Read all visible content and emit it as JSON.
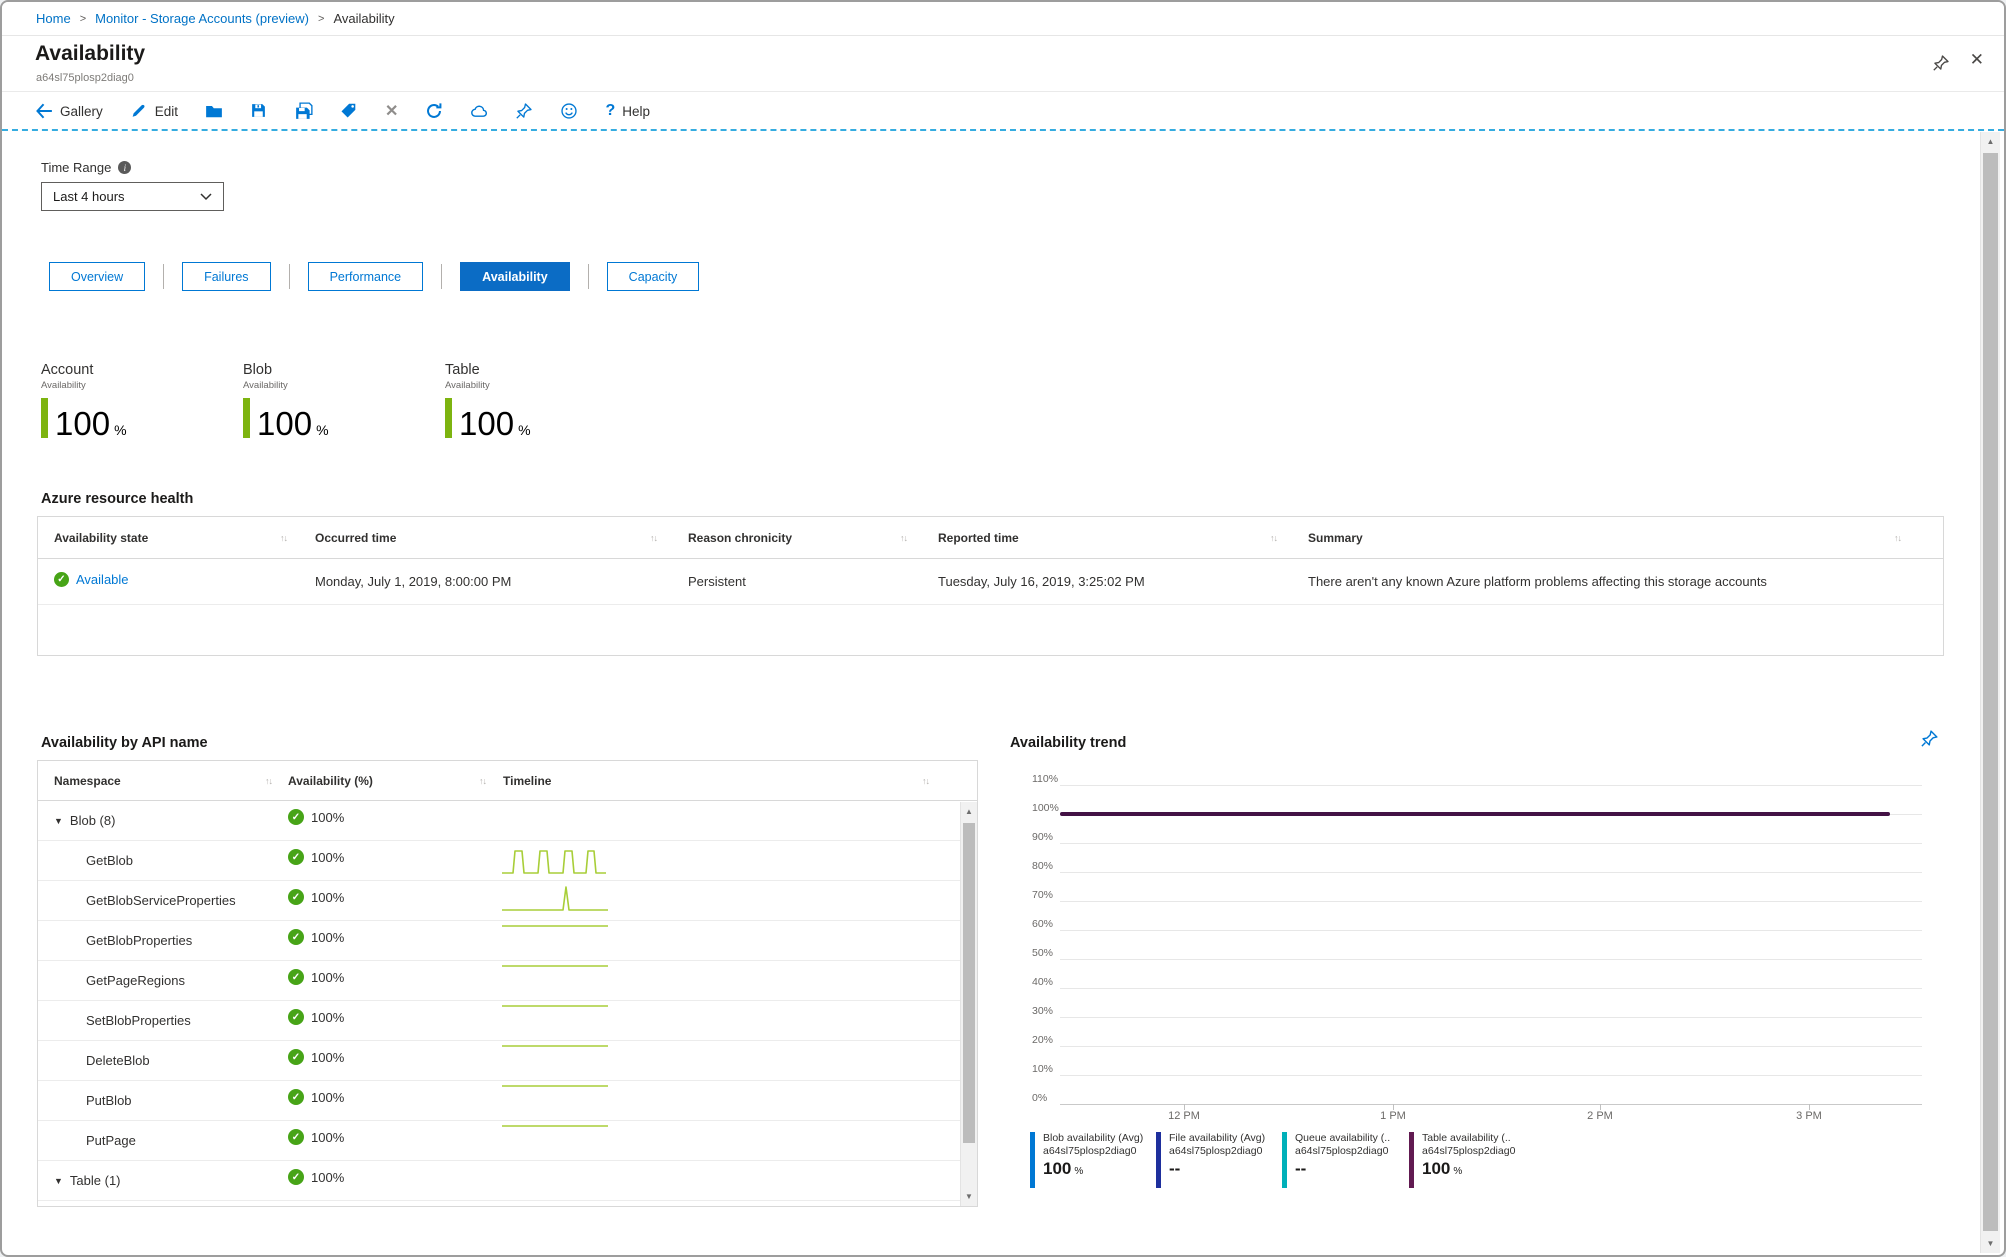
{
  "breadcrumb": {
    "separator": ">",
    "items": [
      {
        "label": "Home"
      },
      {
        "label": "Monitor - Storage Accounts (preview)"
      },
      {
        "label": "Availability"
      }
    ]
  },
  "header": {
    "title": "Availability",
    "subtitle": "a64sl75plosp2diag0"
  },
  "toolbar": {
    "gallery": "Gallery",
    "edit": "Edit",
    "help": "Help"
  },
  "icons": {
    "close": "✕",
    "cancel_x": "✕",
    "help_q": "?",
    "sort": "↑↓",
    "expander_down": "▼",
    "scroll_up": "▲",
    "scroll_down": "▼",
    "check": "✓",
    "info": "i",
    "names": [
      "back-arrow-icon",
      "edit-pencil-icon",
      "folder-icon",
      "save-icon",
      "save-all-icon",
      "tag-icon",
      "close-x-icon",
      "refresh-icon",
      "cloud-icon",
      "pin-icon",
      "smiley-icon",
      "help-icon"
    ]
  },
  "filters": {
    "time_range_label": "Time Range",
    "time_range_value": "Last 4 hours"
  },
  "tabs": [
    {
      "label": "Overview",
      "selected": false
    },
    {
      "label": "Failures",
      "selected": false
    },
    {
      "label": "Performance",
      "selected": false
    },
    {
      "label": "Availability",
      "selected": true
    },
    {
      "label": "Capacity",
      "selected": false
    }
  ],
  "tiles": [
    {
      "name": "Account",
      "metric": "Availability",
      "value": "100",
      "unit": "%"
    },
    {
      "name": "Blob",
      "metric": "Availability",
      "value": "100",
      "unit": "%"
    },
    {
      "name": "Table",
      "metric": "Availability",
      "value": "100",
      "unit": "%"
    }
  ],
  "resource_health": {
    "title": "Azure resource health",
    "columns": [
      "Availability state",
      "Occurred time",
      "Reason chronicity",
      "Reported time",
      "Summary"
    ],
    "row": {
      "state": "Available",
      "occurred_time": "Monday, July 1, 2019, 8:00:00 PM",
      "reason_chronicity": "Persistent",
      "reported_time": "Tuesday, July 16, 2019, 3:25:02 PM",
      "summary": "There aren't any known Azure platform problems affecting this storage accounts"
    }
  },
  "api_table": {
    "title": "Availability by API name",
    "columns": [
      "Namespace",
      "Availability (%)",
      "Timeline"
    ],
    "rows": [
      {
        "name": "Blob (8)",
        "availability": "100%",
        "group": true,
        "timeline": "none"
      },
      {
        "name": "GetBlob",
        "availability": "100%",
        "group": false,
        "timeline": "pulses"
      },
      {
        "name": "GetBlobServiceProperties",
        "availability": "100%",
        "group": false,
        "timeline": "spike"
      },
      {
        "name": "GetBlobProperties",
        "availability": "100%",
        "group": false,
        "timeline": "flat"
      },
      {
        "name": "GetPageRegions",
        "availability": "100%",
        "group": false,
        "timeline": "flat"
      },
      {
        "name": "SetBlobProperties",
        "availability": "100%",
        "group": false,
        "timeline": "flat"
      },
      {
        "name": "DeleteBlob",
        "availability": "100%",
        "group": false,
        "timeline": "flat"
      },
      {
        "name": "PutBlob",
        "availability": "100%",
        "group": false,
        "timeline": "flat"
      },
      {
        "name": "PutPage",
        "availability": "100%",
        "group": false,
        "timeline": "flat"
      },
      {
        "name": "Table (1)",
        "availability": "100%",
        "group": true,
        "timeline": "none"
      }
    ]
  },
  "trend": {
    "title": "Availability trend",
    "type": "line",
    "y_ticks": [
      "110%",
      "100%",
      "90%",
      "80%",
      "70%",
      "60%",
      "50%",
      "40%",
      "30%",
      "20%",
      "10%",
      "0%"
    ],
    "x_ticks": [
      "12 PM",
      "1 PM",
      "2 PM",
      "3 PM"
    ],
    "line": {
      "value": "100%",
      "color": "#431245"
    },
    "series": [
      {
        "name": "Blob availability (Avg)",
        "resource": "a64sl75plosp2diag0",
        "value": "100",
        "unit": "%",
        "color": "#0078d4"
      },
      {
        "name": "File availability (Avg)",
        "resource": "a64sl75plosp2diag0",
        "value": "--",
        "unit": "",
        "color": "#1e2f9d"
      },
      {
        "name": "Queue availability (..",
        "resource": "a64sl75plosp2diag0",
        "value": "--",
        "unit": "",
        "color": "#00b0b9"
      },
      {
        "name": "Table availability (..",
        "resource": "a64sl75plosp2diag0",
        "value": "100",
        "unit": "%",
        "color": "#611a51"
      }
    ]
  },
  "colors": {
    "accent_blue": "#0078d4",
    "selected_tab": "#0b6cc5",
    "tile_green": "#7db410",
    "check_green": "#47a417",
    "sparkline_green": "#a8ce38",
    "trend_line_purple": "#431245",
    "dashed_divider": "#35ace0"
  }
}
